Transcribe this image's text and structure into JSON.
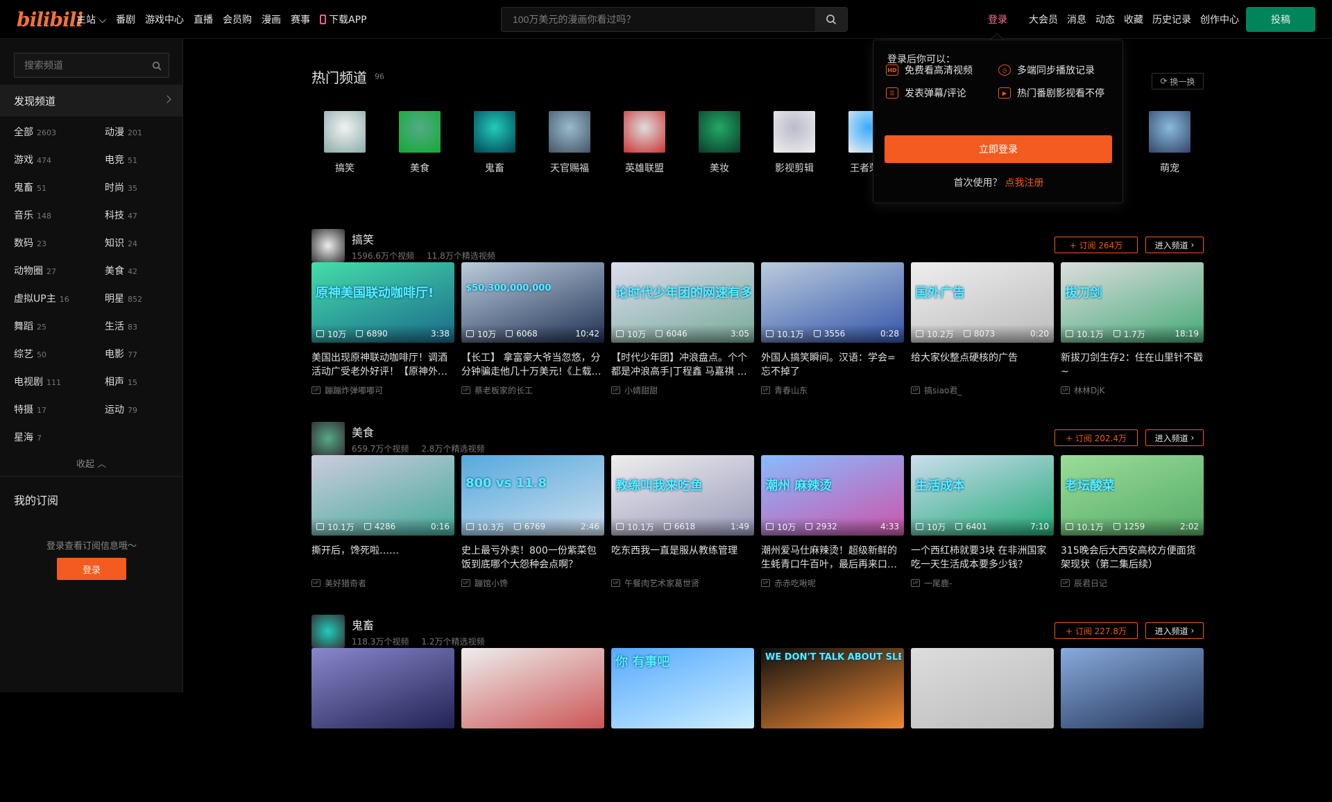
{
  "header": {
    "logo": "bilibili",
    "nav": [
      "主站",
      "番剧",
      "游戏中心",
      "直播",
      "会员购",
      "漫画",
      "赛事",
      "下载APP"
    ],
    "search_placeholder": "100万美元的漫画你看过吗？",
    "login": "登录",
    "right_nav": [
      "大会员",
      "消息",
      "动态",
      "收藏",
      "历史记录",
      "创作中心"
    ],
    "upload": "投稿"
  },
  "sidebar": {
    "search_placeholder": "搜索频道",
    "discover": "发现频道",
    "categories": [
      {
        "name": "全部",
        "count": "2603"
      },
      {
        "name": "动漫",
        "count": "201"
      },
      {
        "name": "游戏",
        "count": "474"
      },
      {
        "name": "电竞",
        "count": "51"
      },
      {
        "name": "鬼畜",
        "count": "51"
      },
      {
        "name": "时尚",
        "count": "35"
      },
      {
        "name": "音乐",
        "count": "148"
      },
      {
        "name": "科技",
        "count": "47"
      },
      {
        "name": "数码",
        "count": "23"
      },
      {
        "name": "知识",
        "count": "24"
      },
      {
        "name": "动物圈",
        "count": "27"
      },
      {
        "name": "美食",
        "count": "42"
      },
      {
        "name": "虚拟UP主",
        "count": "16"
      },
      {
        "name": "明星",
        "count": "852"
      },
      {
        "name": "舞蹈",
        "count": "25"
      },
      {
        "name": "生活",
        "count": "83"
      },
      {
        "name": "综艺",
        "count": "50"
      },
      {
        "name": "电影",
        "count": "77"
      },
      {
        "name": "电视剧",
        "count": "111"
      },
      {
        "name": "相声",
        "count": "15"
      },
      {
        "name": "特摄",
        "count": "17"
      },
      {
        "name": "运动",
        "count": "79"
      },
      {
        "name": "星海",
        "count": "7"
      }
    ],
    "collapse": "收起",
    "my_sub": "我的订阅",
    "sub_hint": "登录查看订阅信息哦～",
    "login_btn": "登录"
  },
  "hot": {
    "title": "热门频道",
    "count": "96",
    "refresh": "换一换",
    "channels": [
      "搞笑",
      "美食",
      "鬼畜",
      "天官赐福",
      "英雄联盟",
      "美妆",
      "影视剪辑",
      "王者荣耀",
      "萌宠"
    ]
  },
  "sections": [
    {
      "name": "搞笑",
      "videos_count": "1596.6万个视频",
      "featured_count": "11.8万个精选视频",
      "subscribe": "+ 订阅 264万",
      "enter": "进入频道",
      "cards": [
        {
          "views": "10万",
          "likes": "6890",
          "duration": "3:38",
          "title": "美国出现原神联动咖啡厅！调酒活动广受老外好评！【原神外…",
          "up": "蹦蹦炸弹嘟嘟可",
          "caption": "原神美国联动咖啡厅!"
        },
        {
          "views": "10万",
          "likes": "6068",
          "duration": "10:42",
          "title": "【长工】 拿富豪大爷当忽悠，分分钟骗走他几十万美元!《上载…",
          "up": "蔡老板家的长工",
          "caption": "$50,300,000,000"
        },
        {
          "views": "10万",
          "likes": "6046",
          "duration": "3:05",
          "title": "【时代少年团】冲浪盘点。个个都是冲浪高手|丁程鑫 马嘉祺 …",
          "up": "小婧甜甜",
          "caption": "论时代少年团的网速有多快"
        },
        {
          "views": "10.1万",
          "likes": "3556",
          "duration": "0:28",
          "title": "外国人搞笑瞬间。汉语：学会=忘不掉了",
          "up": "青春山东",
          "caption": ""
        },
        {
          "views": "10.2万",
          "likes": "8073",
          "duration": "0:20",
          "title": "给大家伙整点硬核的广告",
          "up": "搞siao君_",
          "caption": "国外广告"
        },
        {
          "views": "10.1万",
          "likes": "1.7万",
          "duration": "18:19",
          "title": "新拔刀剑生存2：住在山里针不戳~",
          "up": "林林DjK",
          "caption": "拔刀剑"
        }
      ]
    },
    {
      "name": "美食",
      "videos_count": "659.7万个视频",
      "featured_count": "2.8万个精选视频",
      "subscribe": "+ 订阅 202.4万",
      "enter": "进入频道",
      "cards": [
        {
          "views": "10.1万",
          "likes": "4286",
          "duration": "0:16",
          "title": "撕开后，馋死啦……",
          "up": "美好猎奇者",
          "caption": ""
        },
        {
          "views": "10.3万",
          "likes": "6769",
          "duration": "2:46",
          "title": "史上最亏外卖！800一份紫菜包饭到底哪个大怨种会点啊？",
          "up": "蹦馆小馋",
          "caption": "800 vs 11.8"
        },
        {
          "views": "10.1万",
          "likes": "6618",
          "duration": "1:49",
          "title": "吃东西我一直是服从教练管理",
          "up": "午餐肉艺术家葛世贤",
          "caption": "教练叫我来吃鱼"
        },
        {
          "views": "10万",
          "likes": "2932",
          "duration": "4:33",
          "title": "潮州爱马仕麻辣烫！超级新鲜的生蚝青口牛百叶，最后再来口…",
          "up": "赤赤吃啾呢",
          "caption": "潮州  麻辣烫"
        },
        {
          "views": "10万",
          "likes": "6401",
          "duration": "7:10",
          "title": "一个西红柿就要3块 在非洲国家吃一天生活成本要多少钱？",
          "up": "一尾鹿-",
          "caption": "生活成本"
        },
        {
          "views": "10.1万",
          "likes": "1259",
          "duration": "2:02",
          "title": "315晚会后大西安高校方便面货架现状（第二集后续）",
          "up": "辰君日记",
          "caption": "老坛酸菜"
        }
      ]
    },
    {
      "name": "鬼畜",
      "videos_count": "118.3万个视频",
      "featured_count": "1.2万个精选视频",
      "subscribe": "+ 订阅 227.8万",
      "enter": "进入频道",
      "cards": [
        {
          "views": "",
          "likes": "",
          "duration": "",
          "title": "",
          "up": "",
          "caption": ""
        },
        {
          "views": "",
          "likes": "",
          "duration": "",
          "title": "",
          "up": "",
          "caption": ""
        },
        {
          "views": "",
          "likes": "",
          "duration": "",
          "title": "",
          "up": "",
          "caption": "你 有事吧"
        },
        {
          "views": "",
          "likes": "",
          "duration": "",
          "title": "",
          "up": "",
          "caption": "WE DON'T TALK ABOUT SLEEPY JOE"
        },
        {
          "views": "",
          "likes": "",
          "duration": "",
          "title": "",
          "up": "",
          "caption": ""
        },
        {
          "views": "",
          "likes": "",
          "duration": "",
          "title": "",
          "up": "",
          "caption": ""
        }
      ]
    }
  ],
  "popup": {
    "title": "登录后你可以：",
    "features": [
      "免费看高清视频",
      "多端同步播放记录",
      "发表弹幕/评论",
      "热门番剧影视看不停"
    ],
    "feature_icons": [
      "HD",
      "clock",
      "list",
      "play"
    ],
    "login": "立即登录",
    "register_prompt": "首次使用？",
    "register_link": "点我注册"
  },
  "colors": {
    "accent": "#f25a12",
    "pink": "#fb7299",
    "upload": "#00855b"
  }
}
